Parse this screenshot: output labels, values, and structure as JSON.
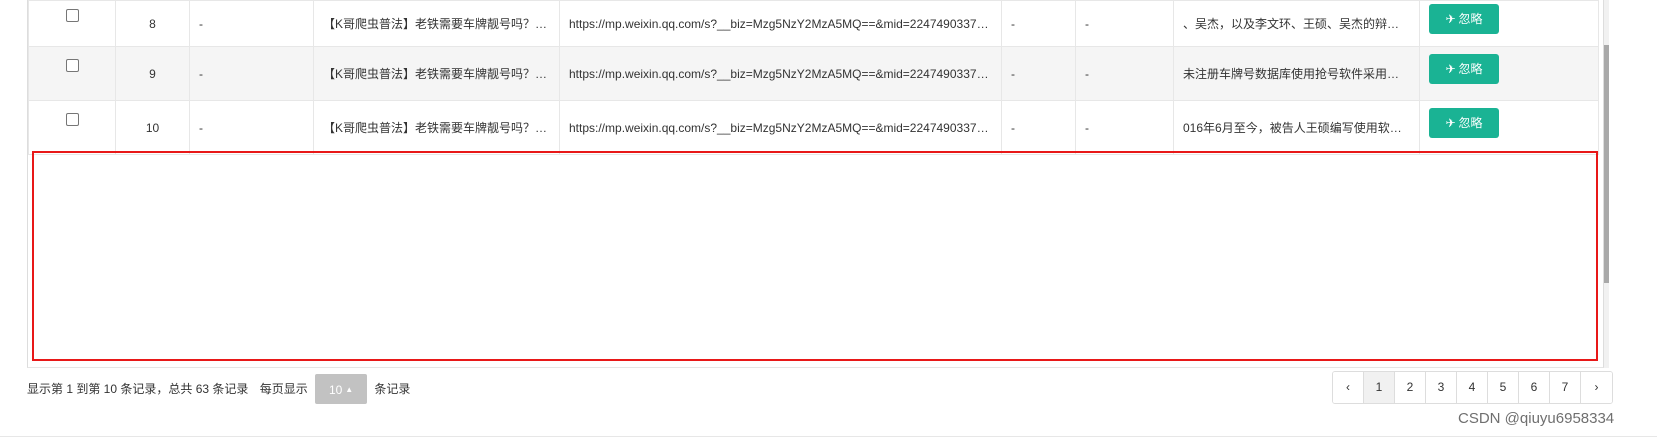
{
  "table": {
    "rows": [
      {
        "no": "8",
        "col2": "-",
        "title": "【K哥爬虫普法】老铁需要车牌靓号吗？判...",
        "url": "https://mp.weixin.qq.com/s?__biz=Mzg5NzY2MzA5MQ==&mid=2247490337&idx...",
        "col5": "-",
        "col6": "-",
        "summary": "、吴杰，以及李文环、王硕、吴杰的辩护人...",
        "action": "忽略"
      },
      {
        "no": "9",
        "col2": "-",
        "title": "【K哥爬虫普法】老铁需要车牌靓号吗？判...",
        "url": "https://mp.weixin.qq.com/s?__biz=Mzg5NzY2MzA5MQ==&mid=2247490337&idx...",
        "col5": "-",
        "col6": "-",
        "summary": "未注册车牌号数据库使用抢号软件采用多线...",
        "action": "忽略"
      },
      {
        "no": "10",
        "col2": "-",
        "title": "【K哥爬虫普法】老铁需要车牌靓号吗？判...",
        "url": "https://mp.weixin.qq.com/s?__biz=Mzg5NzY2MzA5MQ==&mid=2247490337&idx...",
        "col5": "-",
        "col6": "-",
        "summary": "016年6月至今，被告人王硕编写使用软件登...",
        "action": "忽略"
      }
    ]
  },
  "pager": {
    "info": "显示第 1 到第 10 条记录，总共 63 条记录",
    "per_page_prefix": "每页显示",
    "page_size": "10",
    "per_page_suffix": "条记录",
    "prev": "‹",
    "next": "›",
    "pages": [
      "1",
      "2",
      "3",
      "4",
      "5",
      "6",
      "7"
    ],
    "active_page": "1"
  },
  "watermark": "CSDN @qiuyu6958334",
  "colors": {
    "accent_button": "#1ab394",
    "highlight_box": "#e81818",
    "page_size_bg": "#c2c2c2"
  }
}
